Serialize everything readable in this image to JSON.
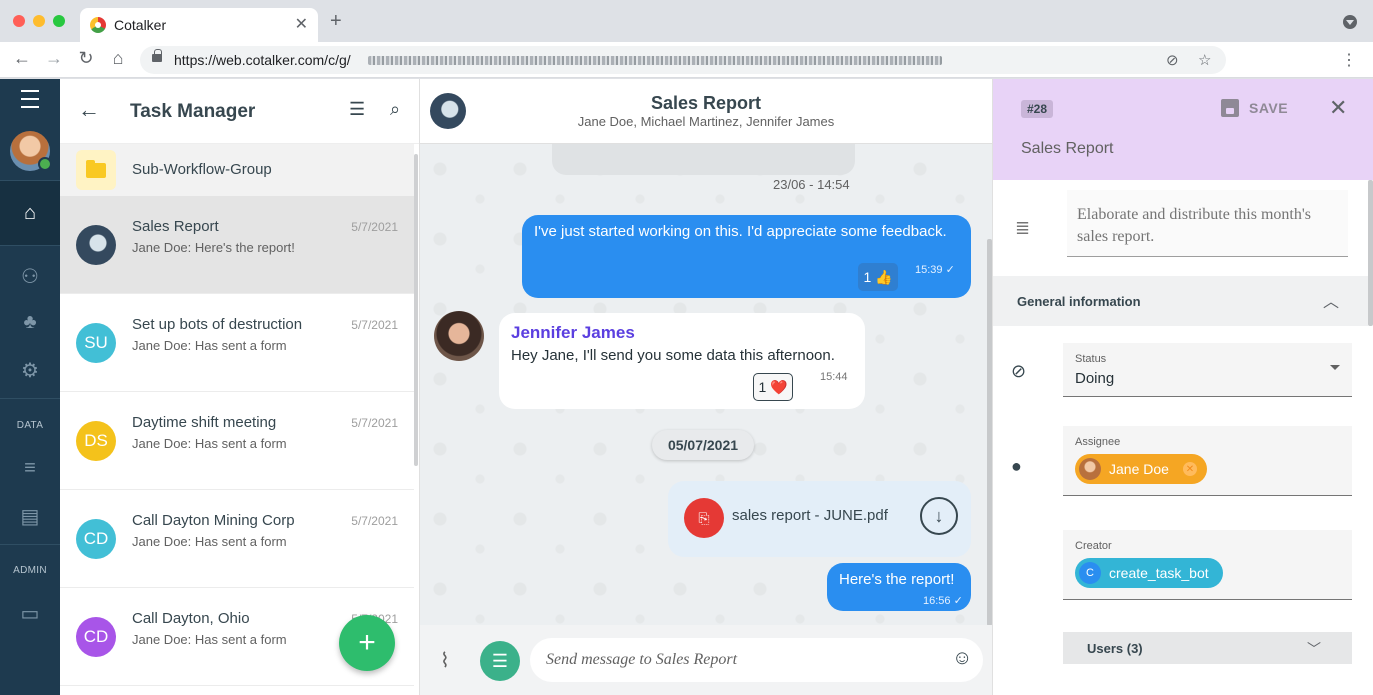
{
  "browser": {
    "tab_title": "Cotalker",
    "url": "https://web.cotalker.com/c/g/"
  },
  "rail": {
    "data_label": "DATA",
    "admin_label": "ADMIN"
  },
  "list": {
    "title": "Task Manager",
    "group_label": "Sub-Workflow-Group",
    "conversations": [
      {
        "title": "Sales Report",
        "subtitle": "Jane Doe: Here's the report!",
        "date": "5/7/2021",
        "initials": ""
      },
      {
        "title": "Set up bots of destruction",
        "subtitle": "Jane Doe: Has sent a form",
        "date": "5/7/2021",
        "initials": "SU"
      },
      {
        "title": "Daytime shift meeting",
        "subtitle": "Jane Doe: Has sent a form",
        "date": "5/7/2021",
        "initials": "DS"
      },
      {
        "title": "Call Dayton Mining Corp",
        "subtitle": "Jane Doe: Has sent a form",
        "date": "5/7/2021",
        "initials": "CD"
      },
      {
        "title": "Call Dayton, Ohio",
        "subtitle": "Jane Doe: Has sent a form",
        "date": "5/7/2021",
        "initials": "CD"
      }
    ],
    "avatar_colors": [
      "#42bfd6",
      "#f4c21b",
      "#42bfd6",
      "#a855e8"
    ],
    "fab_label": "+"
  },
  "chat": {
    "title": "Sales Report",
    "members": "Jane Doe, Michael Martinez, Jennifer James",
    "prev_timestamp": "23/06 - 14:54",
    "messages": [
      {
        "text": "I've just started working on this. I'd appreciate some feedback.",
        "time": "15:39 ✓",
        "reaction": "1 👍"
      },
      {
        "sender": "Jennifer James",
        "text": "Hey Jane, I'll send you some data this afternoon.",
        "time": "15:44",
        "reaction": "1 ❤️"
      },
      {
        "file": "sales report - JUNE.pdf"
      },
      {
        "text": "Here's the report!",
        "time": "16:56 ✓"
      }
    ],
    "date_divider": "05/07/2021",
    "input_placeholder": "Send message to Sales Report"
  },
  "task": {
    "id": "#28",
    "save_label": "SAVE",
    "name": "Sales Report",
    "description": "Elaborate and distribute this month's sales report.",
    "section_label": "General information",
    "status_label": "Status",
    "status_value": "Doing",
    "assignee_label": "Assignee",
    "assignee_name": "Jane Doe",
    "creator_label": "Creator",
    "creator_name": "create_task_bot",
    "creator_initial": "C",
    "users_label": "Users (3)"
  },
  "colors": {
    "rail": "#1e3a4f",
    "bubble_out": "#2a8ef0",
    "sender": "#5b3fe0",
    "fab": "#2ebd6d",
    "task_header": "#e8d3f7",
    "assignee_chip": "#f5a623",
    "creator_chip": "#33b5d6"
  }
}
